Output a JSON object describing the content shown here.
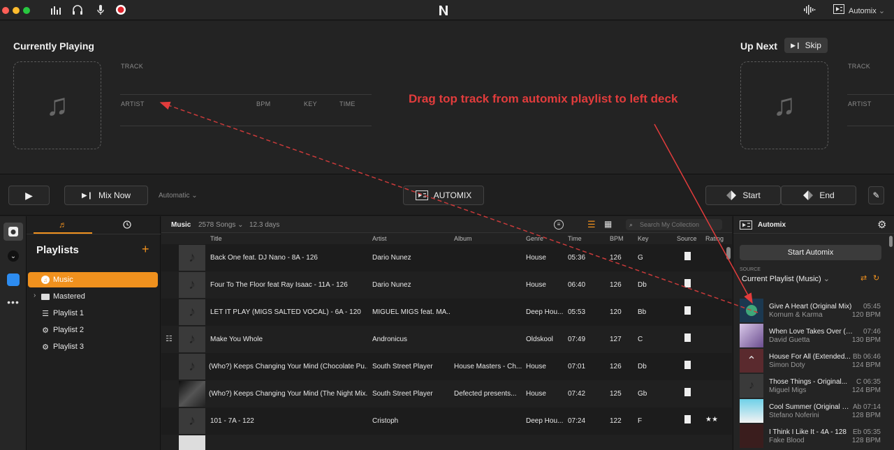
{
  "titlebar": {
    "automix_label": "Automix"
  },
  "deck": {
    "currently_playing": "Currently Playing",
    "up_next": "Up Next",
    "skip": "Skip",
    "left_labels": {
      "track": "TRACK",
      "artist": "ARTIST",
      "bpm": "BPM",
      "key": "KEY",
      "time": "TIME"
    },
    "right_labels": {
      "track": "TRACK",
      "artist": "ARTIST"
    }
  },
  "annotation": "Drag top track from automix playlist to left deck",
  "transport": {
    "mix_now": "Mix Now",
    "mode": "Automatic",
    "automix": "AUTOMIX",
    "start": "Start",
    "end": "End"
  },
  "sidebar": {
    "title": "Playlists",
    "items": [
      {
        "label": "Music",
        "active": true
      },
      {
        "label": "Mastered"
      },
      {
        "label": "Playlist 1"
      },
      {
        "label": "Playlist 2"
      },
      {
        "label": "Playlist 3"
      }
    ]
  },
  "collection": {
    "name": "Music",
    "songs": "2578 Songs",
    "duration": "12.3 days",
    "search_placeholder": "Search My Collection",
    "columns": [
      "Title",
      "Artist",
      "Album",
      "Genre",
      "Time",
      "BPM",
      "Key",
      "Source",
      "Rating"
    ],
    "rows": [
      {
        "title": "Back One feat. DJ Nano - 8A - 126",
        "artist": "Dario Nunez",
        "album": "",
        "genre": "House",
        "time": "05:36",
        "bpm": "126",
        "key": "G"
      },
      {
        "title": "Four To The Floor feat Ray Isaac - 11A - 126",
        "artist": "Dario Nunez",
        "album": "",
        "genre": "House",
        "time": "06:40",
        "bpm": "126",
        "key": "Db"
      },
      {
        "title": "LET IT PLAY (MIGS SALTED VOCAL) - 6A - 120",
        "artist": "MIGUEL MIGS feat. MA...",
        "album": "",
        "genre": "Deep Hou...",
        "time": "05:53",
        "bpm": "120",
        "key": "Bb"
      },
      {
        "title": "Make You Whole",
        "artist": "Andronicus",
        "album": "",
        "genre": "Oldskool",
        "time": "07:49",
        "bpm": "127",
        "key": "C"
      },
      {
        "title": "(Who?) Keeps Changing Your Mind (Chocolate Pu...",
        "artist": "South Street Player",
        "album": "House Masters - Ch...",
        "genre": "House",
        "time": "07:01",
        "bpm": "126",
        "key": "Db"
      },
      {
        "title": "(Who?) Keeps Changing Your Mind (The Night Mix...",
        "artist": "South Street Player",
        "album": "Defected presents...",
        "genre": "House",
        "time": "07:42",
        "bpm": "125",
        "key": "Gb"
      },
      {
        "title": "101 - 7A - 122",
        "artist": "Cristoph",
        "album": "",
        "genre": "Deep Hou...",
        "time": "07:24",
        "bpm": "122",
        "key": "F",
        "rating": "★★"
      }
    ]
  },
  "automix": {
    "title": "Automix",
    "start_button": "Start Automix",
    "source_label": "SOURCE",
    "source_value": "Current Playlist (Music)",
    "queue": [
      {
        "title": "Give A Heart (Original Mix)",
        "artist": "Kornum & Karma",
        "time": "05:45",
        "bpm": "120 BPM"
      },
      {
        "title": "When Love Takes Over (f...",
        "artist": "David Guetta",
        "time": "07:46",
        "bpm": "130 BPM"
      },
      {
        "title": "House For All (Extended...",
        "artist": "Simon Doty",
        "time": "Bb 06:46",
        "bpm": "124 BPM"
      },
      {
        "title": "Those Things - Original...",
        "artist": "Miguel Migs",
        "time": "C 06:35",
        "bpm": "124 BPM"
      },
      {
        "title": "Cool Summer (Original D...",
        "artist": "Stefano Noferini",
        "time": "Ab 07:14",
        "bpm": "128 BPM"
      },
      {
        "title": "I Think I Like It - 4A - 128",
        "artist": "Fake Blood",
        "time": "Eb 05:35",
        "bpm": "128 BPM"
      }
    ]
  },
  "colors": {
    "accent": "#f0911e",
    "annotation": "#e23c3c"
  }
}
